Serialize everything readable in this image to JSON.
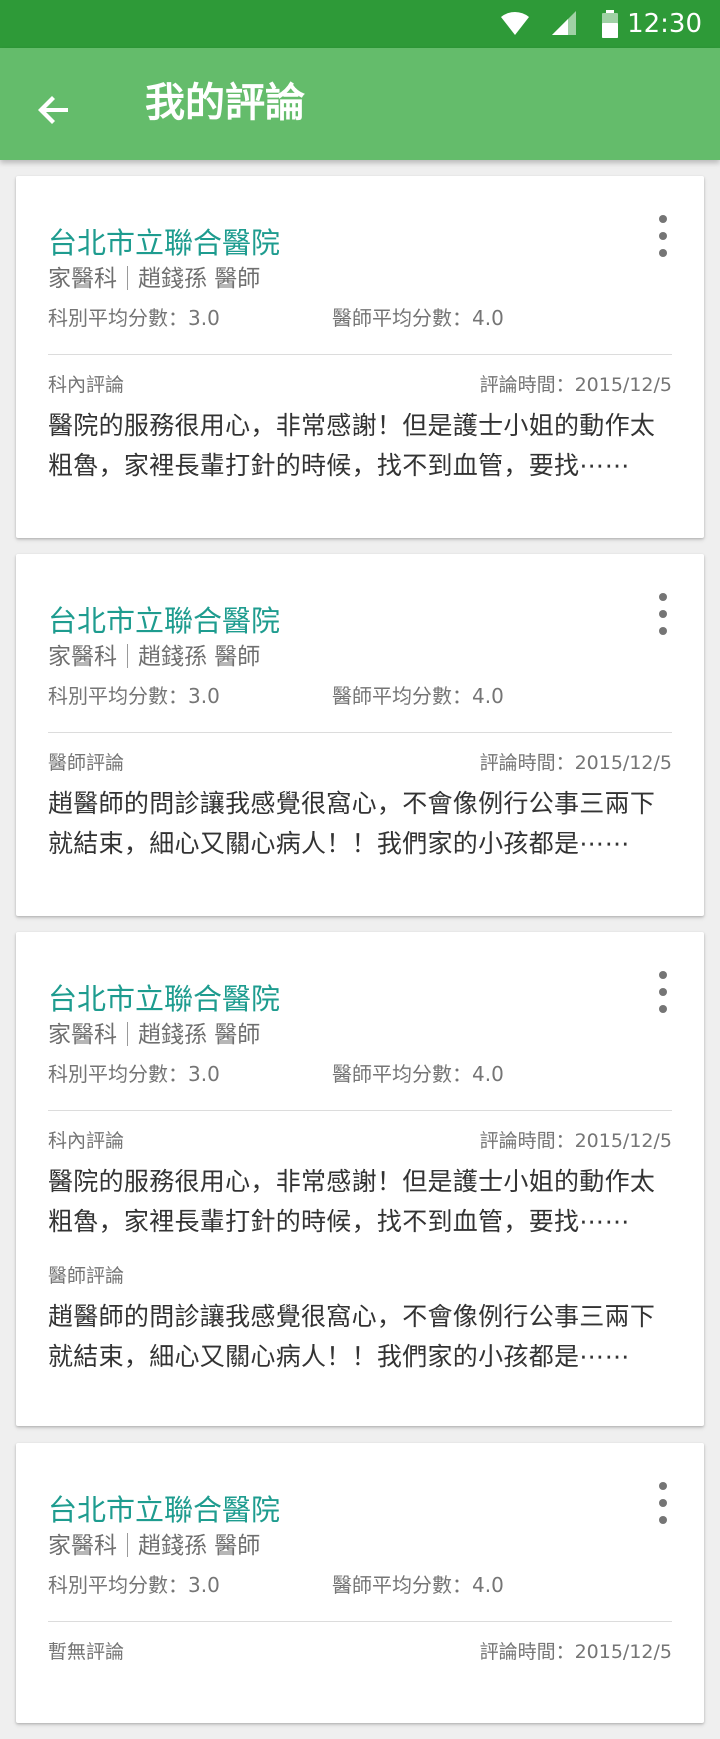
{
  "status_bar": {
    "time": "12:30",
    "icons": [
      "wifi-icon",
      "signal-icon",
      "battery-icon"
    ]
  },
  "app_bar": {
    "title": "我的評論",
    "back_icon": "arrow-back-icon"
  },
  "colors": {
    "status_bar": "#2e9a38",
    "app_bar": "#64bc6b",
    "hospital_name": "#1e9c8f"
  },
  "reviews": [
    {
      "hospital": "台北市立聯合醫院",
      "department": "家醫科",
      "doctor": "趙錢孫 醫師",
      "dept_score": "科別平均分數：3.0",
      "doctor_score": "醫師平均分數：4.0",
      "time": "評論時間：2015/12/5",
      "sections": [
        {
          "label": "科內評論",
          "text": "醫院的服務很用心，非常感謝！但是護士小姐的動作太粗魯，家裡長輩打針的時候，找不到血管，要找⋯⋯"
        }
      ]
    },
    {
      "hospital": "台北市立聯合醫院",
      "department": "家醫科",
      "doctor": "趙錢孫 醫師",
      "dept_score": "科別平均分數：3.0",
      "doctor_score": "醫師平均分數：4.0",
      "time": "評論時間：2015/12/5",
      "sections": [
        {
          "label": "醫師評論",
          "text": "趙醫師的問診讓我感覺很窩心，不會像例行公事三兩下就結束，細心又關心病人！！我們家的小孩都是⋯⋯"
        }
      ]
    },
    {
      "hospital": "台北市立聯合醫院",
      "department": "家醫科",
      "doctor": "趙錢孫 醫師",
      "dept_score": "科別平均分數：3.0",
      "doctor_score": "醫師平均分數：4.0",
      "time": "評論時間：2015/12/5",
      "sections": [
        {
          "label": "科內評論",
          "text": "醫院的服務很用心，非常感謝！但是護士小姐的動作太粗魯，家裡長輩打針的時候，找不到血管，要找⋯⋯"
        },
        {
          "label": "醫師評論",
          "text": "趙醫師的問診讓我感覺很窩心，不會像例行公事三兩下就結束，細心又關心病人！！我們家的小孩都是⋯⋯"
        }
      ]
    },
    {
      "hospital": "台北市立聯合醫院",
      "department": "家醫科",
      "doctor": "趙錢孫 醫師",
      "dept_score": "科別平均分數：3.0",
      "doctor_score": "醫師平均分數：4.0",
      "time": "評論時間：2015/12/5",
      "sections": [
        {
          "label": "暫無評論",
          "text": ""
        }
      ]
    }
  ]
}
